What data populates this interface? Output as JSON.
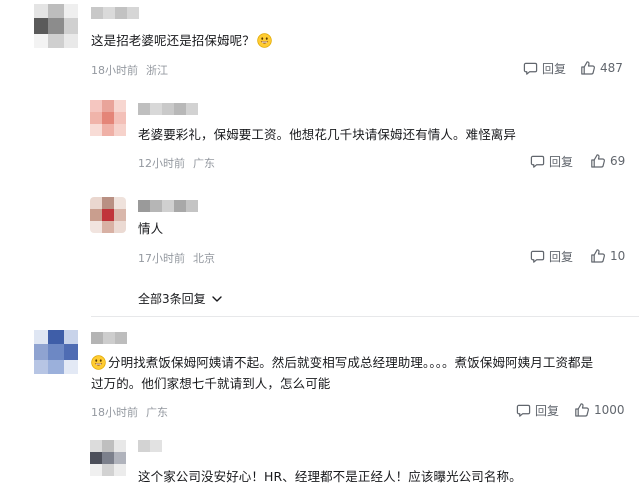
{
  "comments": [
    {
      "text": "这是招老婆呢还是招保姆呢？",
      "emoji": "grinning-face-emoji",
      "time": "18小时前",
      "location": "浙江",
      "reply_label": "回复",
      "likes": "487",
      "replies": [
        {
          "text": "老婆要彩礼，保姆要工资。他想花几千块请保姆还有情人。难怪离异",
          "time": "12小时前",
          "location": "广东",
          "reply_label": "回复",
          "likes": "69"
        },
        {
          "text": "情人",
          "time": "17小时前",
          "location": "北京",
          "reply_label": "回复",
          "likes": "10"
        }
      ],
      "all_replies_label": "全部3条回复"
    },
    {
      "emoji": "grinning-face-emoji",
      "text_line1": "分明找煮饭保姆阿姨请不起。然后就变相写成总经理助理。。。。煮饭保姆阿姨月工资都是",
      "text_line2": "过万的。他们家想七千就请到人，怎么可能",
      "time": "18小时前",
      "location": "广东",
      "reply_label": "回复",
      "likes": "1000",
      "replies": [
        {
          "text": "这个家公司没安好心！HR、经理都不是正经人！应该曝光公司名称。"
        }
      ]
    }
  ],
  "icons": {
    "reply": "reply-bubble-icon",
    "like": "thumbs-up-icon",
    "expand": "chevron-down-icon"
  },
  "colors": {
    "text": "#18191c",
    "meta": "#9499a0",
    "action": "#61666d"
  }
}
